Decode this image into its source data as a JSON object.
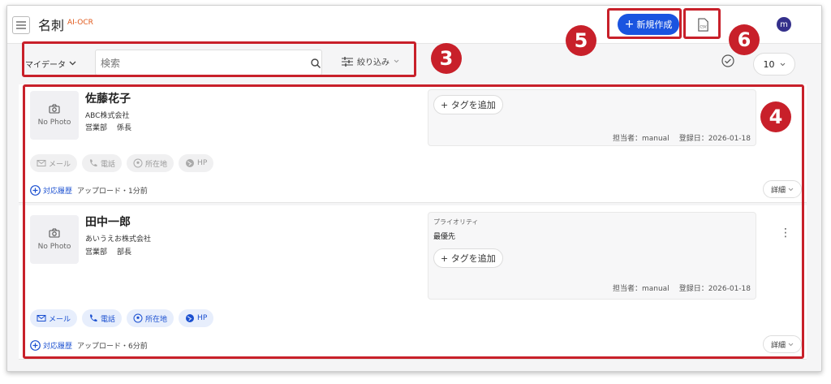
{
  "header": {
    "title": "名刺",
    "badge": "AI-OCR",
    "new_button": "新規作成",
    "csv_label": "CSV",
    "avatar_initial": "m"
  },
  "filter": {
    "data_select": "マイデータ",
    "search_placeholder": "検索",
    "filter_label": "絞り込み",
    "per_page": "10"
  },
  "annotations": {
    "a3": "3",
    "a4": "4",
    "a5": "5",
    "a6": "6"
  },
  "colors": {
    "accent": "#1a54e0",
    "annotation": "#c8202a",
    "brand": "#e0581a"
  },
  "cards": [
    {
      "no_photo": "No Photo",
      "name": "佐藤花子",
      "company": "ABC株式会社",
      "department": "営業部",
      "position": "係長",
      "tag_button": "+ タグを追加",
      "owner": "担当者：manual",
      "registered": "登録日：2026-01-18",
      "chips": {
        "mail": "メール",
        "phone": "電話",
        "location": "所在地",
        "hp": "HP"
      },
      "history_button": "対応履歴",
      "history_time": "アップロード・1分前",
      "detail_button": "詳細"
    },
    {
      "no_photo": "No Photo",
      "name": "田中一郎",
      "company": "あいうえお株式会社",
      "department": "営業部",
      "position": "部長",
      "priority_label": "プライオリティ",
      "priority_value": "最優先",
      "tag_button": "+ タグを追加",
      "owner": "担当者：manual",
      "registered": "登録日：2026-01-18",
      "chips": {
        "mail": "メール",
        "phone": "電話",
        "location": "所在地",
        "hp": "HP"
      },
      "history_button": "対応履歴",
      "history_time": "アップロード・6分前",
      "detail_button": "詳細"
    }
  ]
}
